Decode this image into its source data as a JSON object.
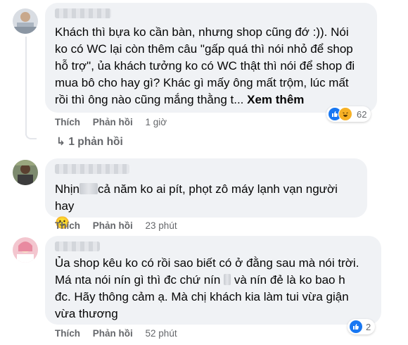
{
  "comments": [
    {
      "text_lines": [
        "Khách thì bựa ko cần bàn, nhưng shop cũng đớ :)). Nói",
        "ko có WC lại còn thêm câu \"gấp quá thì nói nhỏ để shop",
        "hỗ trợ\", ủa khách tưởng ko có WC thật thì nói để shop đi",
        "mua bô cho hay gì? Khác gì mấy ông mất trộm, lúc mất",
        "rồi thì ông nào cũng mắng thằng t..."
      ],
      "see_more": "Xem thêm",
      "like_label": "Thích",
      "reply_label": "Phản hồi",
      "time": "1 giờ",
      "reaction_count": "62",
      "reaction_icons": [
        "like-icon",
        "haha-icon"
      ]
    },
    {
      "text_lines": [
        "Nhịn",
        "cả năm ko ai pít, phọt zô máy lạnh vạn người hay",
        "🙂"
      ],
      "like_label": "Thích",
      "reply_label": "Phản hồi",
      "time": "23 phút"
    },
    {
      "text_lines": [
        "Ủa shop kêu ko có rồi sao biết có ở đằng sau mà nói trời.",
        "Má nta nói nín gì thì đc chứ nín",
        "và nín đẻ là ko bao h",
        "đc. Hãy thông cảm ạ. Mà chị khách kia làm tui vừa giận",
        "vừa thương"
      ],
      "like_label": "Thích",
      "reply_label": "Phản hồi",
      "time": "52 phút",
      "reaction_count": "2",
      "reaction_icons": [
        "like-icon"
      ]
    }
  ],
  "replies_link": "1 phản hồi",
  "colors": {
    "bubble": "#f0f2f5",
    "meta": "#65676b",
    "like_blue": "#1877f2",
    "haha_yellow": "#f7b125"
  }
}
